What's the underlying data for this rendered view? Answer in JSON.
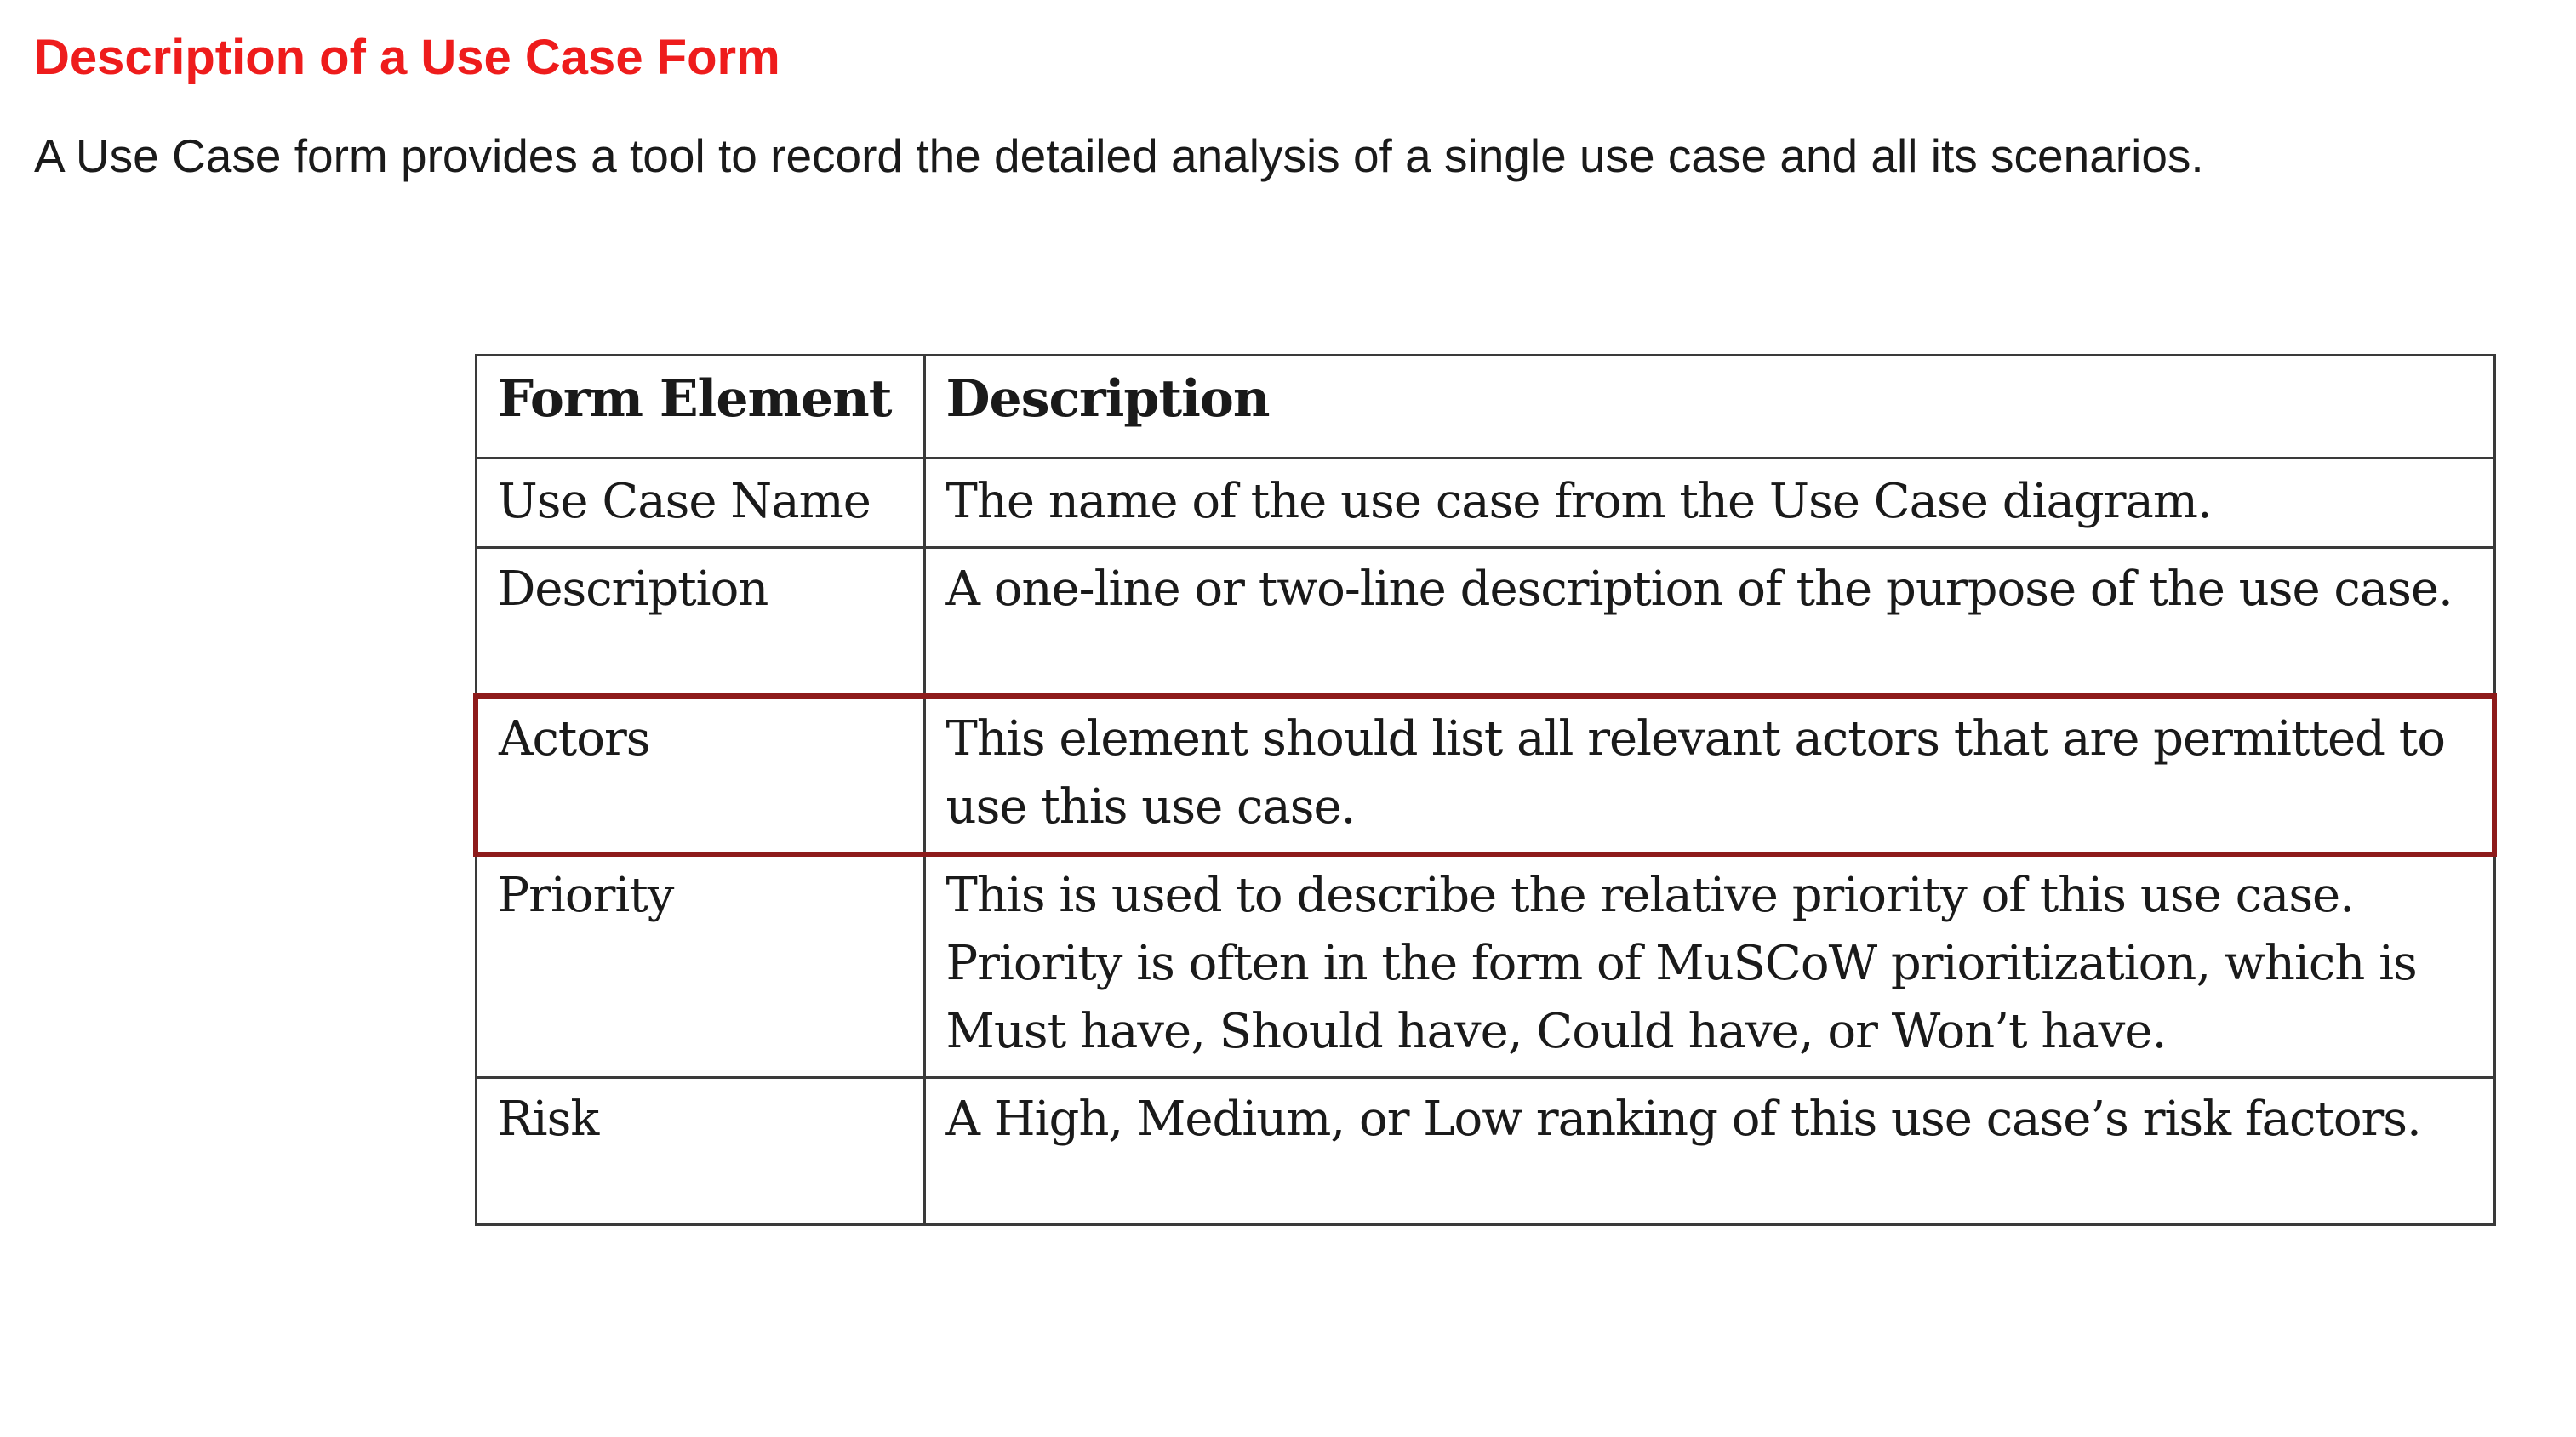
{
  "header": {
    "title": "Description of a Use Case Form",
    "intro": "A Use Case form provides a tool to record the detailed analysis of a single use case and all its scenarios."
  },
  "table": {
    "columns": [
      "Form Element",
      "Description"
    ],
    "rows": [
      {
        "element": "Use Case Name",
        "description": "The name of the use case from the Use Case diagram."
      },
      {
        "element": "Description",
        "description": "A one-line or two-line description of the purpose of the use case."
      },
      {
        "element": "Actors",
        "description": "This element should list all relevant actors that are permitted to use this use case."
      },
      {
        "element": "Priority",
        "description": "This is used to describe the relative priority of this use case. Priority is often in the form of MuSCoW prioritization, which is Must have, Should have, Could have, or Won’t have."
      },
      {
        "element": "Risk",
        "description": "A High, Medium, or Low ranking of this use case’s risk factors."
      }
    ],
    "highlighted_row": "Actors"
  },
  "colors": {
    "title": "#ee1c1c",
    "highlight_border": "#8e1b1b",
    "table_border": "#3a3a3a"
  }
}
